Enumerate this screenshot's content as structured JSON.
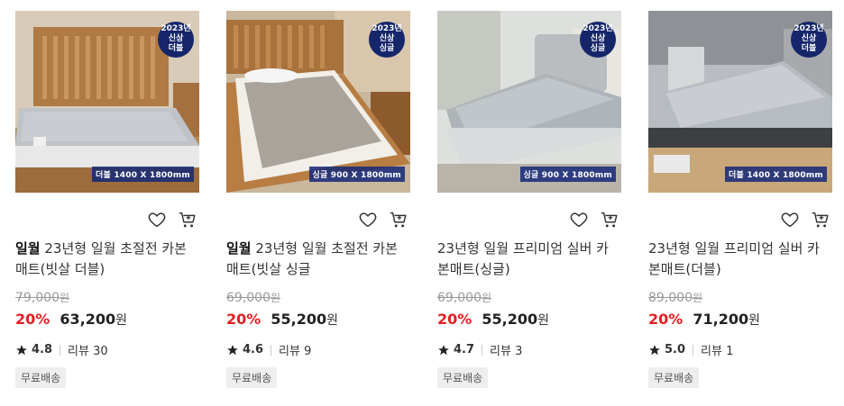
{
  "products": [
    {
      "badge": [
        "2023년",
        "신상",
        "더블"
      ],
      "size_label": "더블 1400 X 1800mm",
      "brand": "일월",
      "title_line1": "23년형 일월 초절전 카본",
      "title_line2": "매트(빗살 더블)",
      "original_price": "79,000",
      "discount": "20%",
      "price": "63,200",
      "won": "원",
      "rating": "4.8",
      "reviews": "리뷰 30",
      "shipping": "무료배송"
    },
    {
      "badge": [
        "2023년",
        "신상",
        "싱글"
      ],
      "size_label": "싱글 900 X 1800mm",
      "brand": "일월",
      "title_line1": "23년형 일월 초절전 카본",
      "title_line2": "매트(빗살 싱글",
      "original_price": "69,000",
      "discount": "20%",
      "price": "55,200",
      "won": "원",
      "rating": "4.6",
      "reviews": "리뷰 9",
      "shipping": "무료배송"
    },
    {
      "badge": [
        "2023년",
        "신상",
        "싱글"
      ],
      "size_label": "싱글 900 X 1800mm",
      "brand": "",
      "title_line1": "23년형 일월 프리미엄 실버 카",
      "title_line2": "본매트(싱글)",
      "original_price": "69,000",
      "discount": "20%",
      "price": "55,200",
      "won": "원",
      "rating": "4.7",
      "reviews": "리뷰 3",
      "shipping": "무료배송"
    },
    {
      "badge": [
        "2023년",
        "신상",
        "더블"
      ],
      "size_label": "더블 1400 X 1800mm",
      "brand": "",
      "title_line1": "23년형 일월 프리미엄 실버 카",
      "title_line2": "본매트(더블)",
      "original_price": "89,000",
      "discount": "20%",
      "price": "71,200",
      "won": "원",
      "rating": "5.0",
      "reviews": "리뷰 1",
      "shipping": "무료배송"
    }
  ],
  "currency_suffix": "원",
  "colors": {
    "discount": "#e31e24",
    "badge_bg": "#16266b",
    "size_tag": "#142878"
  }
}
